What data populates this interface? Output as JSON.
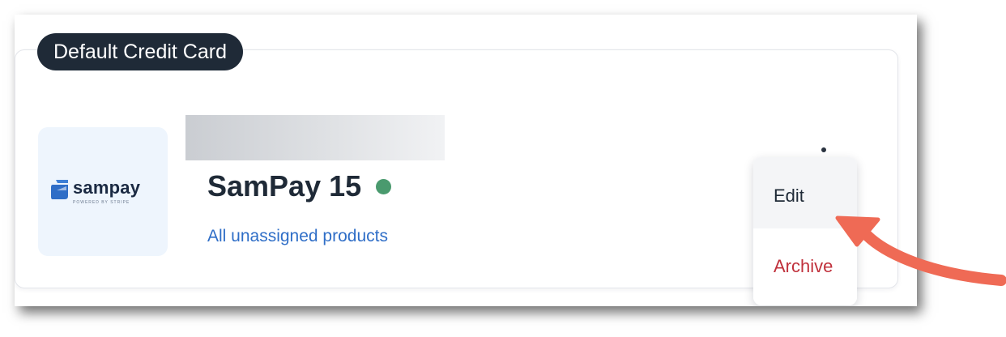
{
  "badge": {
    "label": "Default Credit Card"
  },
  "logo": {
    "wordmark": "sampay",
    "tagline": "POWERED BY STRIPE",
    "color": "#2f6ec7"
  },
  "account": {
    "name": "SamPay 15",
    "status_color": "#4a9a6e",
    "link_text": "All unassigned products"
  },
  "menu": {
    "icon": "more-vertical-icon",
    "items": [
      {
        "label": "Edit",
        "color": "#1f2a37"
      },
      {
        "label": "Archive",
        "color": "#c0313c"
      }
    ]
  },
  "annotation": {
    "icon": "pointer-arrow",
    "color": "#ef6a55"
  }
}
